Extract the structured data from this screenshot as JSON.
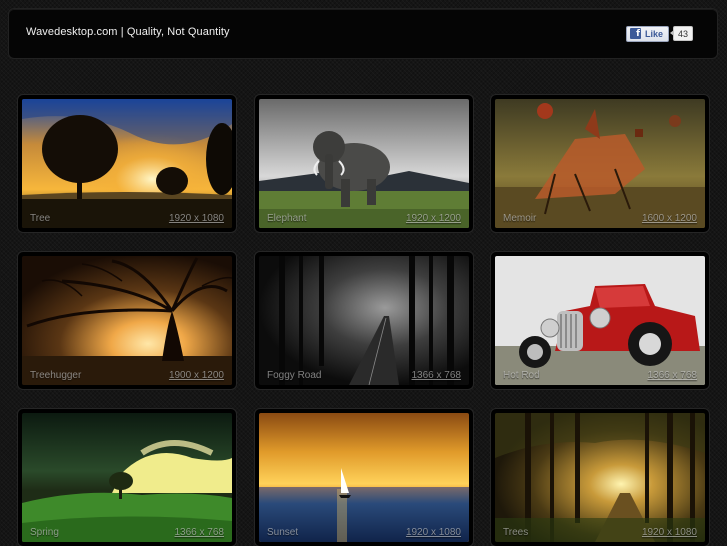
{
  "header": {
    "title": "Wavedesktop.com | Quality, Not Quantity",
    "like_label": "Like",
    "like_count": "43",
    "fb_icon": "facebook-icon",
    "fb_color": "#3b5998"
  },
  "wallpapers": [
    {
      "name": "Tree",
      "resolution": "1920 x 1080"
    },
    {
      "name": "Elephant",
      "resolution": "1920 x 1200"
    },
    {
      "name": "Memoir",
      "resolution": "1600 x 1200"
    },
    {
      "name": "Treehugger",
      "resolution": "1900 x 1200"
    },
    {
      "name": "Foggy Road",
      "resolution": "1366 x 768"
    },
    {
      "name": "Hot Rod",
      "resolution": "1366 x 768"
    },
    {
      "name": "Spring",
      "resolution": "1366 x 768"
    },
    {
      "name": "Sunset",
      "resolution": "1920 x 1080"
    },
    {
      "name": "Trees",
      "resolution": "1920 x 1080"
    }
  ]
}
